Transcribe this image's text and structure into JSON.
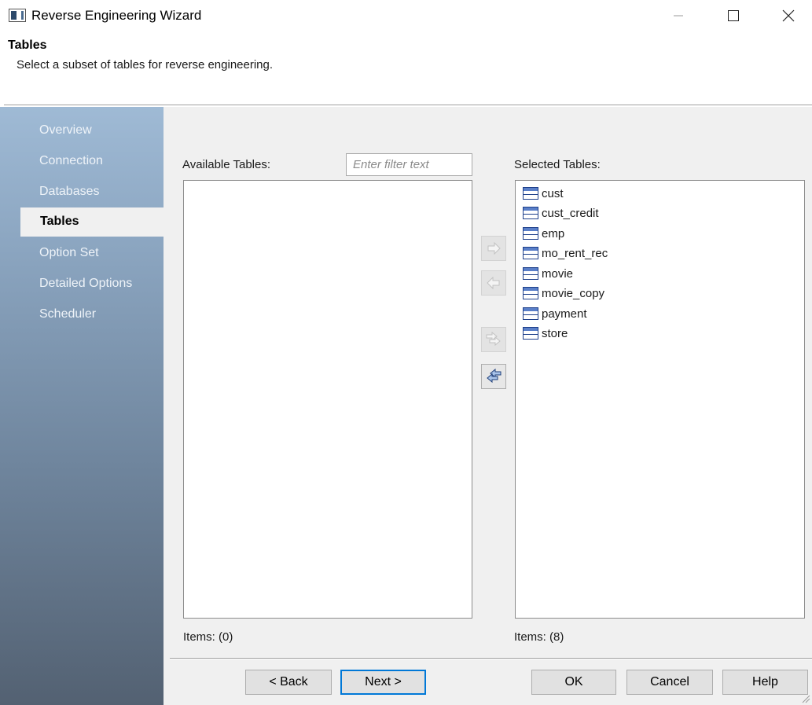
{
  "window": {
    "title": "Reverse Engineering Wizard"
  },
  "header": {
    "title": "Tables",
    "subtitle": "Select a subset of tables for reverse engineering."
  },
  "sidebar": {
    "items": [
      {
        "label": "Overview"
      },
      {
        "label": "Connection"
      },
      {
        "label": "Databases"
      },
      {
        "label": "Tables"
      },
      {
        "label": "Option Set"
      },
      {
        "label": "Detailed Options"
      },
      {
        "label": "Scheduler"
      }
    ],
    "selected": "Tables"
  },
  "available": {
    "label": "Available Tables:",
    "filter_placeholder": "Enter filter text",
    "items_count": "Items: (0)"
  },
  "selected": {
    "label": "Selected Tables:",
    "items": [
      "cust",
      "cust_credit",
      "emp",
      "mo_rent_rec",
      "movie",
      "movie_copy",
      "payment",
      "store"
    ],
    "items_count": "Items: (8)"
  },
  "buttons": {
    "back": "< Back",
    "next": "Next >",
    "ok": "OK",
    "cancel": "Cancel",
    "help": "Help"
  },
  "icons": {
    "app": "app-window-icon",
    "table": "table-icon",
    "move_right": "arrow-right-icon",
    "move_left": "arrow-left-icon",
    "move_all_right": "double-arrow-right-icon",
    "move_all_left": "double-arrow-left-icon"
  },
  "colors": {
    "accent": "#0078d7",
    "table_icon": "#1d3f8a"
  }
}
